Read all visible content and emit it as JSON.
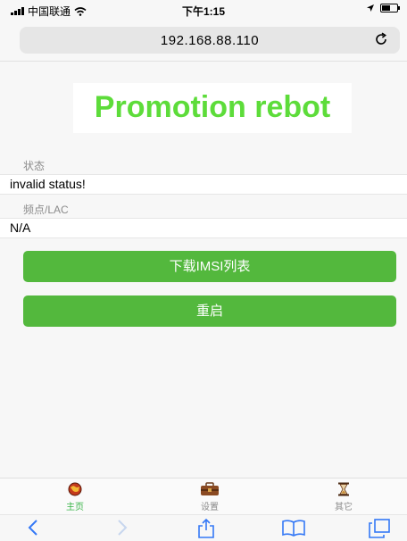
{
  "status_bar": {
    "carrier": "中国联通",
    "time": "下午1:15",
    "icons": [
      "signal-icon",
      "wifi-icon",
      "location-arrow-icon",
      "battery-icon"
    ]
  },
  "browser": {
    "url": "192.168.88.110",
    "reload_icon": "reload-icon"
  },
  "page": {
    "banner_title": "Promotion rebot",
    "status_label": "状态",
    "status_value": "invalid status!",
    "lac_label": "频点/LAC",
    "lac_value": "N/A",
    "download_button": "下载IMSI列表",
    "restart_button": "重启"
  },
  "tabbar": {
    "items": [
      {
        "label": "主页",
        "icon": "home-globe-icon",
        "active": true
      },
      {
        "label": "设置",
        "icon": "toolbox-icon",
        "active": false
      },
      {
        "label": "其它",
        "icon": "hourglass-icon",
        "active": false
      }
    ]
  },
  "browser_toolbar": {
    "icons": [
      "back-icon",
      "forward-icon",
      "share-icon",
      "bookmarks-icon",
      "tabs-icon"
    ]
  },
  "colors": {
    "accent_green": "#53b83d",
    "banner_green": "#5ddc3a",
    "tab_active": "#3bb54a",
    "ios_blue": "#3478f6"
  }
}
